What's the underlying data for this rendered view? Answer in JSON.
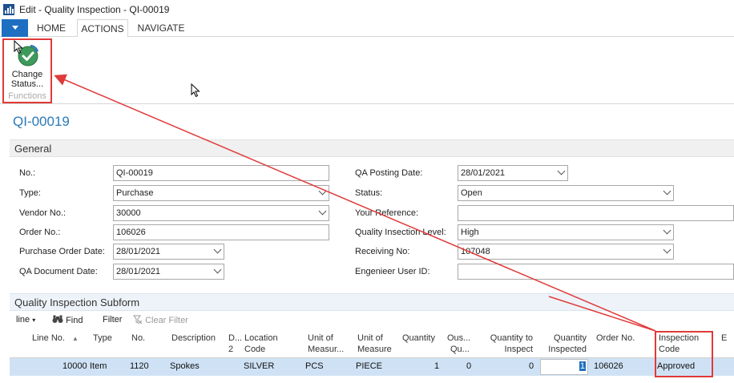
{
  "window": {
    "title": "Edit - Quality Inspection - QI-00019"
  },
  "ribbon": {
    "tabs": [
      {
        "label": "HOME"
      },
      {
        "label": "ACTIONS"
      },
      {
        "label": "NAVIGATE"
      }
    ],
    "group_label": "Functions",
    "change_status_label_1": "Change",
    "change_status_label_2": "Status..."
  },
  "page": {
    "title": "QI-00019"
  },
  "general": {
    "section_title": "General",
    "fields": {
      "no": {
        "label": "No.:",
        "value": "QI-00019"
      },
      "type": {
        "label": "Type:",
        "value": "Purchase"
      },
      "vendor_no": {
        "label": "Vendor No.:",
        "value": "30000"
      },
      "order_no": {
        "label": "Order No.:",
        "value": "106026"
      },
      "purchase_order_date": {
        "label": "Purchase Order Date:",
        "value": "28/01/2021"
      },
      "qa_document_date": {
        "label": "QA Document Date:",
        "value": "28/01/2021"
      },
      "qa_posting_date": {
        "label": "QA Posting Date:",
        "value": "28/01/2021"
      },
      "status": {
        "label": "Status:",
        "value": "Open"
      },
      "your_reference": {
        "label": "Your Reference:",
        "value": ""
      },
      "quality_inspection_level": {
        "label": "Quality Insection Level:",
        "value": "High"
      },
      "receiving_no": {
        "label": "Receiving No:",
        "value": "107048"
      },
      "engineer_user_id": {
        "label": "Engenieer User ID:",
        "value": ""
      }
    }
  },
  "subform": {
    "section_title": "Quality Inspection Subform",
    "toolbar": {
      "line": "line",
      "find": "Find",
      "filter": "Filter",
      "clear_filter": "Clear Filter"
    },
    "columns": {
      "line_no": "Line No.",
      "type": "Type",
      "no": "No.",
      "description": "Description",
      "d2_1": "D...",
      "d2_2": "2",
      "location_code_1": "Location",
      "location_code_2": "Code",
      "uom1_1": "Unit of",
      "uom1_2": "Measur...",
      "uom2_1": "Unit of",
      "uom2_2": "Measure",
      "quantity": "Quantity",
      "outstanding_1": "Ous...",
      "outstanding_2": "Qu...",
      "qty_to_inspect_1": "Quantity to",
      "qty_to_inspect_2": "Inspect",
      "qty_inspected_1": "Quantity",
      "qty_inspected_2": "Inspected",
      "order_no": "Order No.",
      "inspection_code_1": "Inspection",
      "inspection_code_2": "Code",
      "extra": "E"
    },
    "rows": [
      {
        "line_no": "10000",
        "type": "Item",
        "no": "1120",
        "description": "Spokes",
        "location_code": "SILVER",
        "uom1": "PCS",
        "uom2": "PIECE",
        "quantity": "1",
        "outstanding": "0",
        "qty_to_inspect": "0",
        "qty_inspected": "1",
        "order_no": "106026",
        "inspection_code": "Approved"
      }
    ]
  },
  "colors": {
    "accent": "#1e6fc2",
    "title_blue": "#2a7ab8",
    "annotation_red": "#e03a3a",
    "row_selected": "#cfe2f5"
  }
}
